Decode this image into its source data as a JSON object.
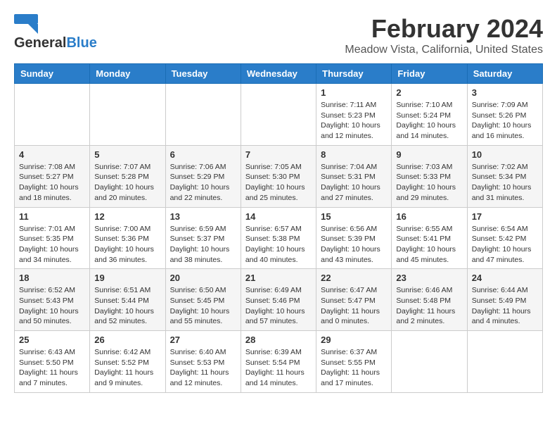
{
  "header": {
    "logo_general": "General",
    "logo_blue": "Blue",
    "month_title": "February 2024",
    "location": "Meadow Vista, California, United States"
  },
  "weekdays": [
    "Sunday",
    "Monday",
    "Tuesday",
    "Wednesday",
    "Thursday",
    "Friday",
    "Saturday"
  ],
  "weeks": [
    [
      {
        "day": "",
        "info": ""
      },
      {
        "day": "",
        "info": ""
      },
      {
        "day": "",
        "info": ""
      },
      {
        "day": "",
        "info": ""
      },
      {
        "day": "1",
        "info": "Sunrise: 7:11 AM\nSunset: 5:23 PM\nDaylight: 10 hours\nand 12 minutes."
      },
      {
        "day": "2",
        "info": "Sunrise: 7:10 AM\nSunset: 5:24 PM\nDaylight: 10 hours\nand 14 minutes."
      },
      {
        "day": "3",
        "info": "Sunrise: 7:09 AM\nSunset: 5:26 PM\nDaylight: 10 hours\nand 16 minutes."
      }
    ],
    [
      {
        "day": "4",
        "info": "Sunrise: 7:08 AM\nSunset: 5:27 PM\nDaylight: 10 hours\nand 18 minutes."
      },
      {
        "day": "5",
        "info": "Sunrise: 7:07 AM\nSunset: 5:28 PM\nDaylight: 10 hours\nand 20 minutes."
      },
      {
        "day": "6",
        "info": "Sunrise: 7:06 AM\nSunset: 5:29 PM\nDaylight: 10 hours\nand 22 minutes."
      },
      {
        "day": "7",
        "info": "Sunrise: 7:05 AM\nSunset: 5:30 PM\nDaylight: 10 hours\nand 25 minutes."
      },
      {
        "day": "8",
        "info": "Sunrise: 7:04 AM\nSunset: 5:31 PM\nDaylight: 10 hours\nand 27 minutes."
      },
      {
        "day": "9",
        "info": "Sunrise: 7:03 AM\nSunset: 5:33 PM\nDaylight: 10 hours\nand 29 minutes."
      },
      {
        "day": "10",
        "info": "Sunrise: 7:02 AM\nSunset: 5:34 PM\nDaylight: 10 hours\nand 31 minutes."
      }
    ],
    [
      {
        "day": "11",
        "info": "Sunrise: 7:01 AM\nSunset: 5:35 PM\nDaylight: 10 hours\nand 34 minutes."
      },
      {
        "day": "12",
        "info": "Sunrise: 7:00 AM\nSunset: 5:36 PM\nDaylight: 10 hours\nand 36 minutes."
      },
      {
        "day": "13",
        "info": "Sunrise: 6:59 AM\nSunset: 5:37 PM\nDaylight: 10 hours\nand 38 minutes."
      },
      {
        "day": "14",
        "info": "Sunrise: 6:57 AM\nSunset: 5:38 PM\nDaylight: 10 hours\nand 40 minutes."
      },
      {
        "day": "15",
        "info": "Sunrise: 6:56 AM\nSunset: 5:39 PM\nDaylight: 10 hours\nand 43 minutes."
      },
      {
        "day": "16",
        "info": "Sunrise: 6:55 AM\nSunset: 5:41 PM\nDaylight: 10 hours\nand 45 minutes."
      },
      {
        "day": "17",
        "info": "Sunrise: 6:54 AM\nSunset: 5:42 PM\nDaylight: 10 hours\nand 47 minutes."
      }
    ],
    [
      {
        "day": "18",
        "info": "Sunrise: 6:52 AM\nSunset: 5:43 PM\nDaylight: 10 hours\nand 50 minutes."
      },
      {
        "day": "19",
        "info": "Sunrise: 6:51 AM\nSunset: 5:44 PM\nDaylight: 10 hours\nand 52 minutes."
      },
      {
        "day": "20",
        "info": "Sunrise: 6:50 AM\nSunset: 5:45 PM\nDaylight: 10 hours\nand 55 minutes."
      },
      {
        "day": "21",
        "info": "Sunrise: 6:49 AM\nSunset: 5:46 PM\nDaylight: 10 hours\nand 57 minutes."
      },
      {
        "day": "22",
        "info": "Sunrise: 6:47 AM\nSunset: 5:47 PM\nDaylight: 11 hours\nand 0 minutes."
      },
      {
        "day": "23",
        "info": "Sunrise: 6:46 AM\nSunset: 5:48 PM\nDaylight: 11 hours\nand 2 minutes."
      },
      {
        "day": "24",
        "info": "Sunrise: 6:44 AM\nSunset: 5:49 PM\nDaylight: 11 hours\nand 4 minutes."
      }
    ],
    [
      {
        "day": "25",
        "info": "Sunrise: 6:43 AM\nSunset: 5:50 PM\nDaylight: 11 hours\nand 7 minutes."
      },
      {
        "day": "26",
        "info": "Sunrise: 6:42 AM\nSunset: 5:52 PM\nDaylight: 11 hours\nand 9 minutes."
      },
      {
        "day": "27",
        "info": "Sunrise: 6:40 AM\nSunset: 5:53 PM\nDaylight: 11 hours\nand 12 minutes."
      },
      {
        "day": "28",
        "info": "Sunrise: 6:39 AM\nSunset: 5:54 PM\nDaylight: 11 hours\nand 14 minutes."
      },
      {
        "day": "29",
        "info": "Sunrise: 6:37 AM\nSunset: 5:55 PM\nDaylight: 11 hours\nand 17 minutes."
      },
      {
        "day": "",
        "info": ""
      },
      {
        "day": "",
        "info": ""
      }
    ]
  ]
}
